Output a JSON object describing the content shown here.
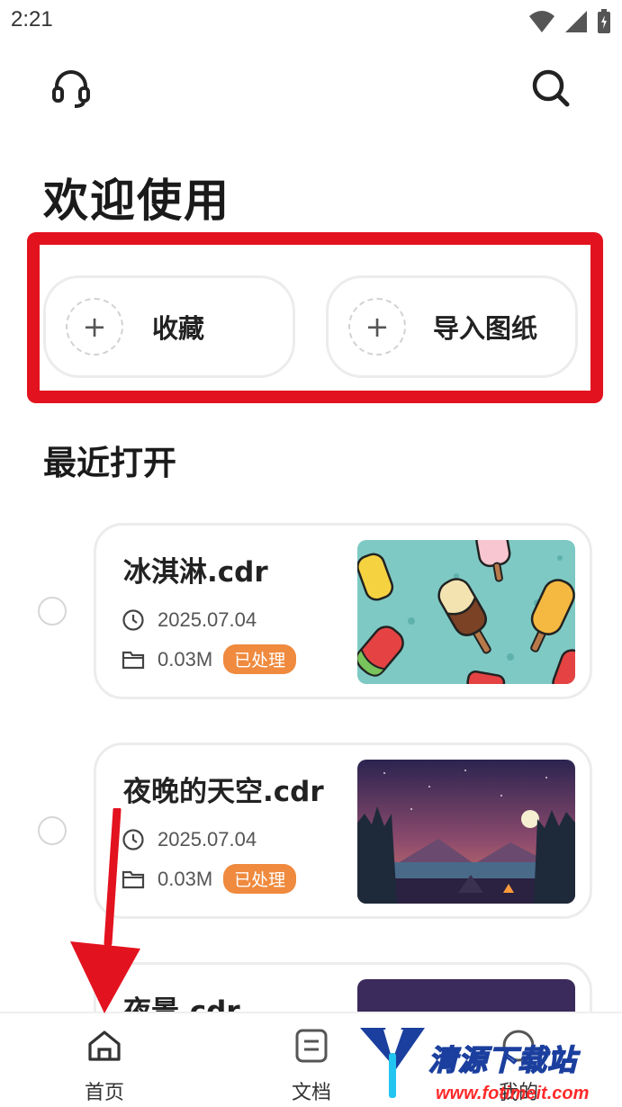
{
  "status_bar": {
    "time": "2:21"
  },
  "header": {
    "title": "欢迎使用"
  },
  "actions": [
    {
      "label": "收藏",
      "icon": "plus-icon"
    },
    {
      "label": "导入图纸",
      "icon": "plus-icon"
    }
  ],
  "recent": {
    "title": "最近打开",
    "files": [
      {
        "name": "冰淇淋.cdr",
        "date": "2025.07.04",
        "size": "0.03M",
        "status": "已处理"
      },
      {
        "name": "夜晚的天空.cdr",
        "date": "2025.07.04",
        "size": "0.03M",
        "status": "已处理"
      },
      {
        "name": "夜景.cdr"
      }
    ]
  },
  "nav": {
    "home": "首页",
    "docs": "文档",
    "mine": "我的"
  },
  "watermark": {
    "title": "清源下载站",
    "url": "www.fotimeit.com"
  },
  "colors": {
    "highlight": "#e3121f",
    "tag": "#ef8a3e",
    "annotation_arrow": "#e3121f"
  }
}
